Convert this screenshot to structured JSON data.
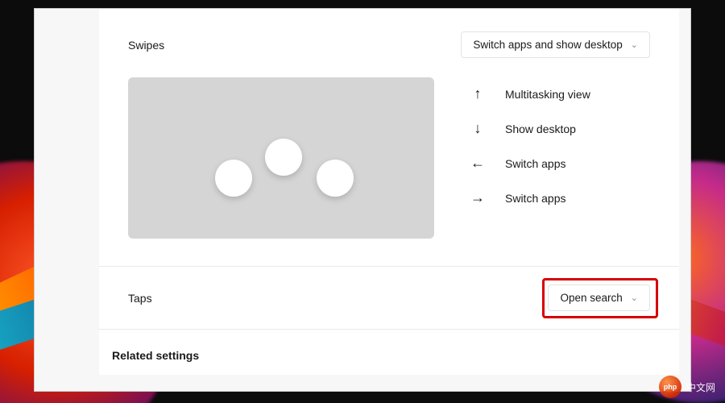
{
  "sections": {
    "swipes": {
      "label": "Swipes",
      "dropdown": "Switch apps and show desktop",
      "gestures": [
        {
          "dir": "up",
          "glyph": "↑",
          "label": "Multitasking view"
        },
        {
          "dir": "down",
          "glyph": "↓",
          "label": "Show desktop"
        },
        {
          "dir": "left",
          "glyph": "←",
          "label": "Switch apps"
        },
        {
          "dir": "right",
          "glyph": "→",
          "label": "Switch apps"
        }
      ]
    },
    "taps": {
      "label": "Taps",
      "dropdown": "Open search"
    },
    "related": {
      "heading": "Related settings"
    }
  },
  "brand": {
    "badge": "php",
    "text": "中文网"
  }
}
